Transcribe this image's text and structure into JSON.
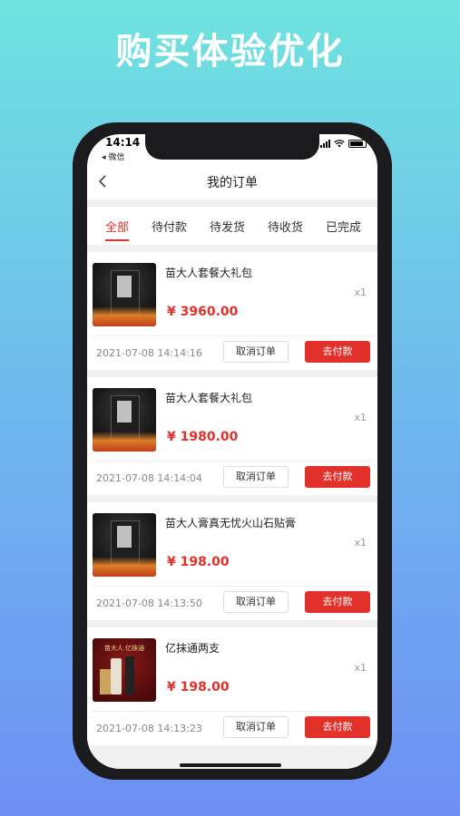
{
  "headline": "购买体验优化",
  "status_bar": {
    "time": "14:14",
    "back_app": "◂ 微信"
  },
  "nav": {
    "title": "我的订单"
  },
  "tabs": [
    {
      "label": "全部",
      "active": true
    },
    {
      "label": "待付款",
      "active": false
    },
    {
      "label": "待发货",
      "active": false
    },
    {
      "label": "待收货",
      "active": false
    },
    {
      "label": "已完成",
      "active": false
    }
  ],
  "orders": [
    {
      "product": "苗大人套餐大礼包",
      "price": "¥ 3960.00",
      "qty": "x1",
      "date": "2021-07-08 14:14:16",
      "cancel": "取消订单",
      "pay": "去付款"
    },
    {
      "product": "苗大人套餐大礼包",
      "price": "¥ 1980.00",
      "qty": "x1",
      "date": "2021-07-08 14:14:04",
      "cancel": "取消订单",
      "pay": "去付款"
    },
    {
      "product": "苗大人膏真无忧火山石贴膏",
      "price": "¥ 198.00",
      "qty": "x1",
      "date": "2021-07-08 14:13:50",
      "cancel": "取消订单",
      "pay": "去付款"
    },
    {
      "product": "亿抹通两支",
      "price": "¥ 198.00",
      "qty": "x1",
      "date": "2021-07-08 14:13:23",
      "cancel": "取消订单",
      "pay": "去付款",
      "image_text": "苗大人 亿抹通"
    }
  ],
  "colors": {
    "accent": "#e2312b",
    "bg_top": "#6fe3df",
    "bg_bottom": "#6e8ff3"
  }
}
